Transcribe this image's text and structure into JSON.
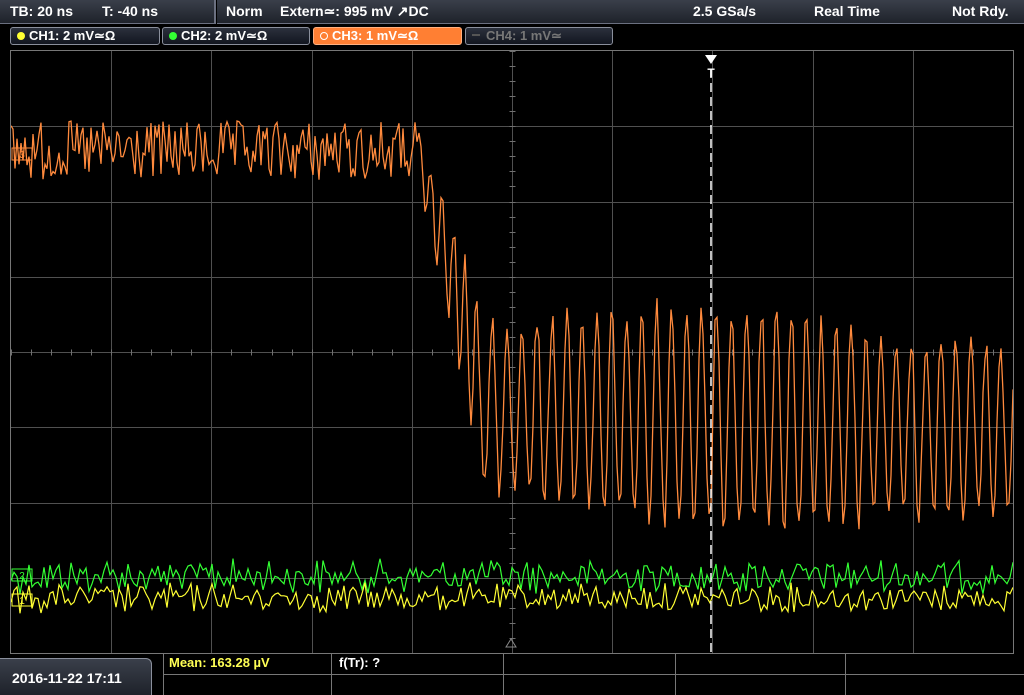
{
  "topbar": {
    "timebase": "TB: 20 ns",
    "trigger_pos": "T: -40 ns",
    "mode": "Norm",
    "trigger": "Extern≃: 995 mV ↗DC",
    "sample_rate": "2.5 GSa/s",
    "acq_mode": "Real Time",
    "status": "Not Rdy."
  },
  "channels": [
    {
      "label": "CH1: 2 mV≃Ω",
      "color": "#ffff33",
      "active": false
    },
    {
      "label": "CH2: 2 mV≃Ω",
      "color": "#33ff33",
      "active": false
    },
    {
      "label": "CH3: 1 mV≃Ω",
      "color": "#ff8a3d",
      "active": true
    },
    {
      "label": "CH4: 1 mV≃",
      "color": "#777777",
      "active": false
    }
  ],
  "screen": {
    "trigger_marker": "T",
    "ch_markers": [
      "3",
      "2",
      "1"
    ]
  },
  "bottom": {
    "datetime": "2016-11-22 17:11",
    "meas1": "Mean: 163.28 µV",
    "meas2": "f(Tr): ?"
  },
  "colors": {
    "ch1": "#ffff33",
    "ch2": "#33ff33",
    "ch3": "#ff8a3d",
    "ch4_disabled": "#777777",
    "grid": "#5a5a5a",
    "measure_text": "#ffff55"
  }
}
